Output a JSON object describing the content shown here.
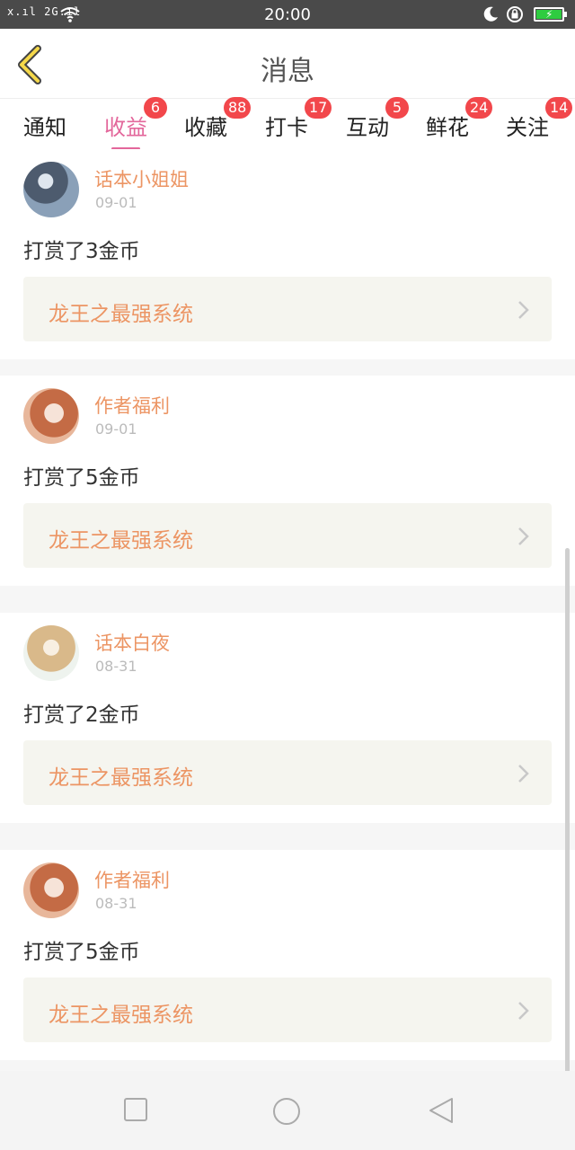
{
  "status_bar": {
    "signal_text": "x.ıl 2G.ıl",
    "time": "20:00",
    "icons": [
      "signal-icon",
      "wifi-icon",
      "moon-icon",
      "rotation-lock-icon",
      "battery-charging-icon"
    ]
  },
  "header": {
    "title": "消息",
    "back_icon": "chevron-left-icon"
  },
  "tabs": [
    {
      "label": "通知",
      "badge": ""
    },
    {
      "label": "收益",
      "badge": "6",
      "active": true
    },
    {
      "label": "收藏",
      "badge": "88"
    },
    {
      "label": "打卡",
      "badge": "17"
    },
    {
      "label": "互动",
      "badge": "5"
    },
    {
      "label": "鲜花",
      "badge": "24"
    },
    {
      "label": "关注",
      "badge": "14"
    }
  ],
  "messages": [
    {
      "sender": "话本小姐姐",
      "date": "09-01",
      "text": "打赏了3金币",
      "book": "龙王之最强系统"
    },
    {
      "sender": "作者福利",
      "date": "09-01",
      "text": "打赏了5金币",
      "book": "龙王之最强系统"
    },
    {
      "sender": "话本白夜",
      "date": "08-31",
      "text": "打赏了2金币",
      "book": "龙王之最强系统"
    },
    {
      "sender": "作者福利",
      "date": "08-31",
      "text": "打赏了5金币",
      "book": "龙王之最强系统"
    }
  ],
  "colors": {
    "accent_pink": "#e3679b",
    "orange_text": "#ec9564",
    "badge_red": "#f2474b",
    "status_bar": "#4a4a4a"
  },
  "nav_bar": {
    "icons": [
      "recent-apps-icon",
      "home-icon",
      "back-icon"
    ]
  }
}
